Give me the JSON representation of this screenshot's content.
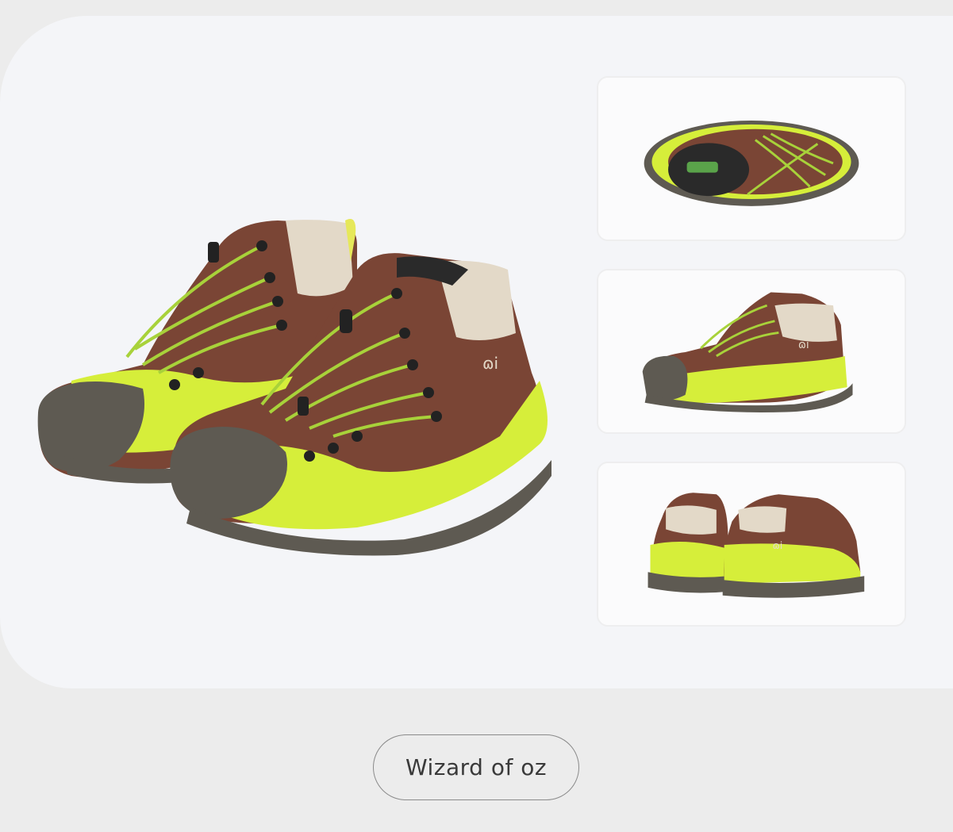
{
  "product": {
    "name_button": "Wizard of oz"
  },
  "gallery": {
    "main_image": "shoe-pair-front-angle",
    "thumbnails": [
      "shoe-top-view",
      "shoe-side-view",
      "shoe-pair-back-view"
    ]
  },
  "colors": {
    "leather_brown": "#7a4535",
    "accent_lime": "#d6ee3a",
    "sole_gray": "#5e5a52",
    "lining_beige": "#e3d9c8"
  }
}
